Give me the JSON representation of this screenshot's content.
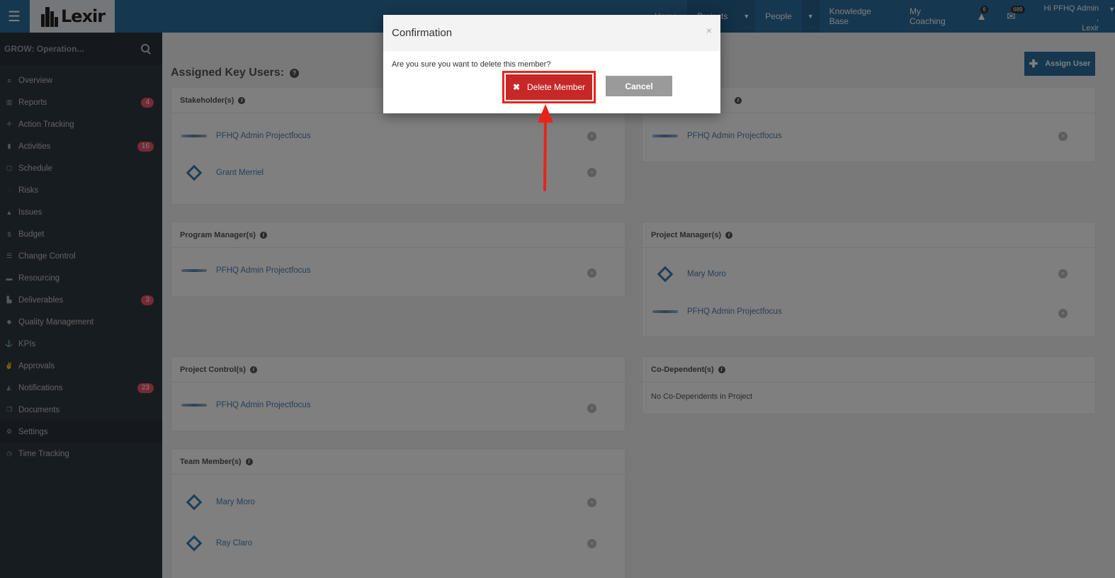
{
  "topbar": {
    "logo_text": "Lexir",
    "nav": [
      {
        "label": "Home"
      },
      {
        "label": "Projects"
      },
      {
        "label": "People"
      },
      {
        "label": "Knowledge Base"
      },
      {
        "label": "My Coaching"
      }
    ],
    "alerts_count": "6",
    "messages_count": "689",
    "greeting_line1": "Hi PFHQ Admin ,",
    "greeting_line2": "Lexir"
  },
  "sidebar": {
    "search_placeholder": "GROW: Operation...",
    "items": [
      {
        "label": "Overview",
        "icon": "overview-icon",
        "glyph": "≡",
        "badge": ""
      },
      {
        "label": "Reports",
        "icon": "bar-chart-icon",
        "glyph": "▥",
        "badge": "4"
      },
      {
        "label": "Action Tracking",
        "icon": "crosshair-icon",
        "glyph": "✛",
        "badge": ""
      },
      {
        "label": "Activities",
        "icon": "bookmark-icon",
        "glyph": "▮",
        "badge": "16"
      },
      {
        "label": "Schedule",
        "icon": "calendar-icon",
        "glyph": "▢",
        "badge": ""
      },
      {
        "label": "Risks",
        "icon": "lightbulb-icon",
        "glyph": "◌",
        "badge": ""
      },
      {
        "label": "Issues",
        "icon": "warning-icon",
        "glyph": "▲",
        "badge": ""
      },
      {
        "label": "Budget",
        "icon": "dollar-icon",
        "glyph": "$",
        "badge": ""
      },
      {
        "label": "Change Control",
        "icon": "list-icon",
        "glyph": "☰",
        "badge": ""
      },
      {
        "label": "Resourcing",
        "icon": "folder-icon",
        "glyph": "▬",
        "badge": ""
      },
      {
        "label": "Deliverables",
        "icon": "truck-icon",
        "glyph": "▙",
        "badge": "3"
      },
      {
        "label": "Quality Management",
        "icon": "tag-icon",
        "glyph": "◆",
        "badge": ""
      },
      {
        "label": "KPIs",
        "icon": "anchor-icon",
        "glyph": "⚓",
        "badge": ""
      },
      {
        "label": "Approvals",
        "icon": "thumbs-up-icon",
        "glyph": "✌",
        "badge": ""
      },
      {
        "label": "Notifications",
        "icon": "bell-icon",
        "glyph": "◭",
        "badge": "23"
      },
      {
        "label": "Documents",
        "icon": "copy-icon",
        "glyph": "❐",
        "badge": ""
      },
      {
        "label": "Settings",
        "icon": "gears-icon",
        "glyph": "⚙",
        "badge": ""
      },
      {
        "label": "Time Tracking",
        "icon": "clock-icon",
        "glyph": "◷",
        "badge": ""
      }
    ]
  },
  "main": {
    "title": "Assigned Key Users:",
    "help_glyph": "?",
    "assign_button": "Assign User",
    "panels": {
      "stakeholders": {
        "title": "Stakeholder(s)",
        "members": [
          "PFHQ Admin Projectfocus",
          "Grant Merriel"
        ]
      },
      "sponsors": {
        "title": "",
        "members": [
          "PFHQ Admin Projectfocus"
        ]
      },
      "program_managers": {
        "title": "Program Manager(s)",
        "members": [
          "PFHQ Admin Projectfocus"
        ]
      },
      "project_managers": {
        "title": "Project Manager(s)",
        "members": [
          "Mary Moro",
          "PFHQ Admin Projectfocus"
        ]
      },
      "project_controls": {
        "title": "Project Control(s)",
        "members": [
          "PFHQ Admin Projectfocus"
        ]
      },
      "co_dependents": {
        "title": "Co-Dependent(s)",
        "empty_text": "No Co-Dependents in Project"
      },
      "team_members": {
        "title": "Team Member(s)",
        "members": [
          "Mary Moro",
          "Ray Claro"
        ]
      }
    }
  },
  "modal": {
    "title": "Confirmation",
    "close_glyph": "×",
    "message": "Are you sure you want to delete this member?",
    "delete_label": "Delete Member",
    "cancel_label": "Cancel"
  },
  "colors": {
    "topbar": "#2b6e9e",
    "sidebar": "#2f3841",
    "delete_button": "#c62828",
    "highlight_outline": "#e8241a",
    "arrow": "#e8241a"
  }
}
